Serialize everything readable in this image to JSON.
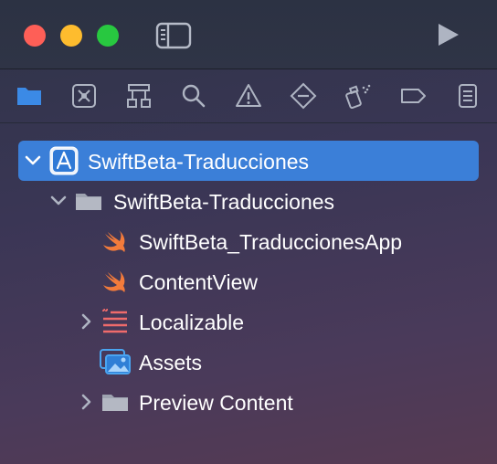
{
  "window": {
    "traffic_lights": [
      "close",
      "minimize",
      "zoom"
    ],
    "colors": {
      "close": "#fe5f57",
      "minimize": "#febc2e",
      "zoom": "#28c840"
    }
  },
  "toolbar": {
    "sidebar_toggle_icon": "sidebar-toggle-icon",
    "run_icon": "play-icon"
  },
  "navigator_tabs": [
    {
      "name": "project-navigator",
      "icon": "folder-icon",
      "selected": true
    },
    {
      "name": "source-control-navigator",
      "icon": "source-control-icon"
    },
    {
      "name": "symbol-navigator",
      "icon": "hierarchy-icon"
    },
    {
      "name": "find-navigator",
      "icon": "magnifier-icon"
    },
    {
      "name": "issue-navigator",
      "icon": "warning-icon"
    },
    {
      "name": "test-navigator",
      "icon": "diamond-minus-icon"
    },
    {
      "name": "debug-navigator",
      "icon": "spray-icon"
    },
    {
      "name": "breakpoint-navigator",
      "icon": "breakpoint-tag-icon"
    },
    {
      "name": "report-navigator",
      "icon": "report-list-icon"
    }
  ],
  "tree": [
    {
      "label": "SwiftBeta-Traducciones",
      "icon": "xcode-project-icon",
      "expanded": true,
      "selected": true
    },
    {
      "label": "SwiftBeta-Traducciones",
      "icon": "folder-icon",
      "expanded": true
    },
    {
      "label": "SwiftBeta_TraduccionesApp",
      "icon": "swift-file-icon"
    },
    {
      "label": "ContentView",
      "icon": "swift-file-icon"
    },
    {
      "label": "Localizable",
      "icon": "strings-file-icon",
      "expanded": false
    },
    {
      "label": "Assets",
      "icon": "asset-catalog-icon"
    },
    {
      "label": "Preview Content",
      "icon": "folder-icon",
      "expanded": false
    }
  ],
  "accent": "#3b7fd8"
}
